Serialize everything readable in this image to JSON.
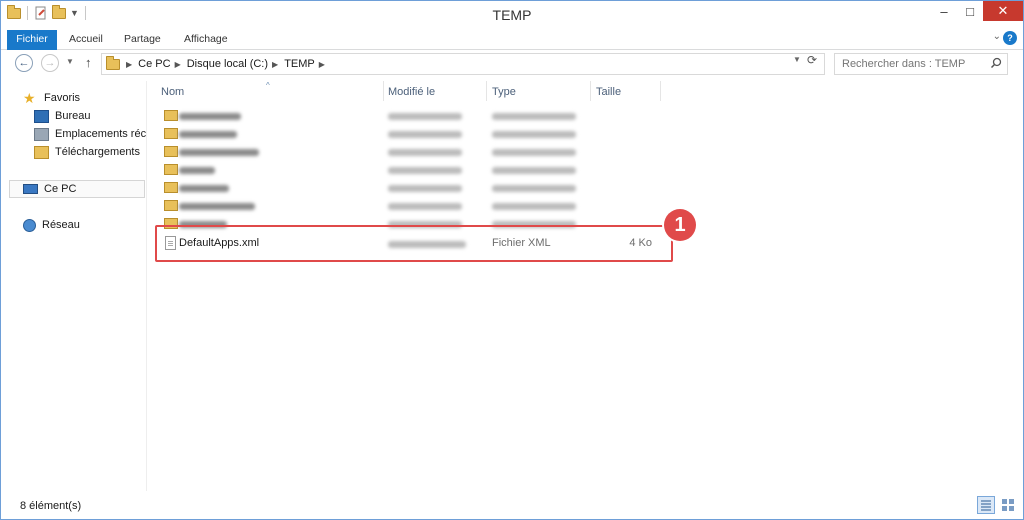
{
  "window": {
    "title": "TEMP",
    "minimize": "–",
    "maximize": "□",
    "close": "✕"
  },
  "ribbon": {
    "tabs": [
      "Fichier",
      "Accueil",
      "Partage",
      "Affichage"
    ],
    "help": "?"
  },
  "nav": {
    "breadcrumb": [
      "Ce PC",
      "Disque local (C:)",
      "TEMP"
    ],
    "search_placeholder": "Rechercher dans : TEMP"
  },
  "sidebar": {
    "favorites": "Favoris",
    "items": [
      "Bureau",
      "Emplacements récents",
      "Téléchargements"
    ],
    "this_pc": "Ce PC",
    "network": "Réseau"
  },
  "columns": [
    "Nom",
    "Modifié le",
    "Type",
    "Taille"
  ],
  "files": {
    "blurred_folders": 7,
    "visible": {
      "name": "DefaultApps.xml",
      "type": "Fichier XML",
      "size": "4 Ko"
    }
  },
  "annotation": {
    "badge": "1"
  },
  "status": {
    "count": "8 élément(s)"
  },
  "colors": {
    "accent": "#1979ca",
    "highlight": "#e04a4a",
    "close": "#c7392e"
  }
}
